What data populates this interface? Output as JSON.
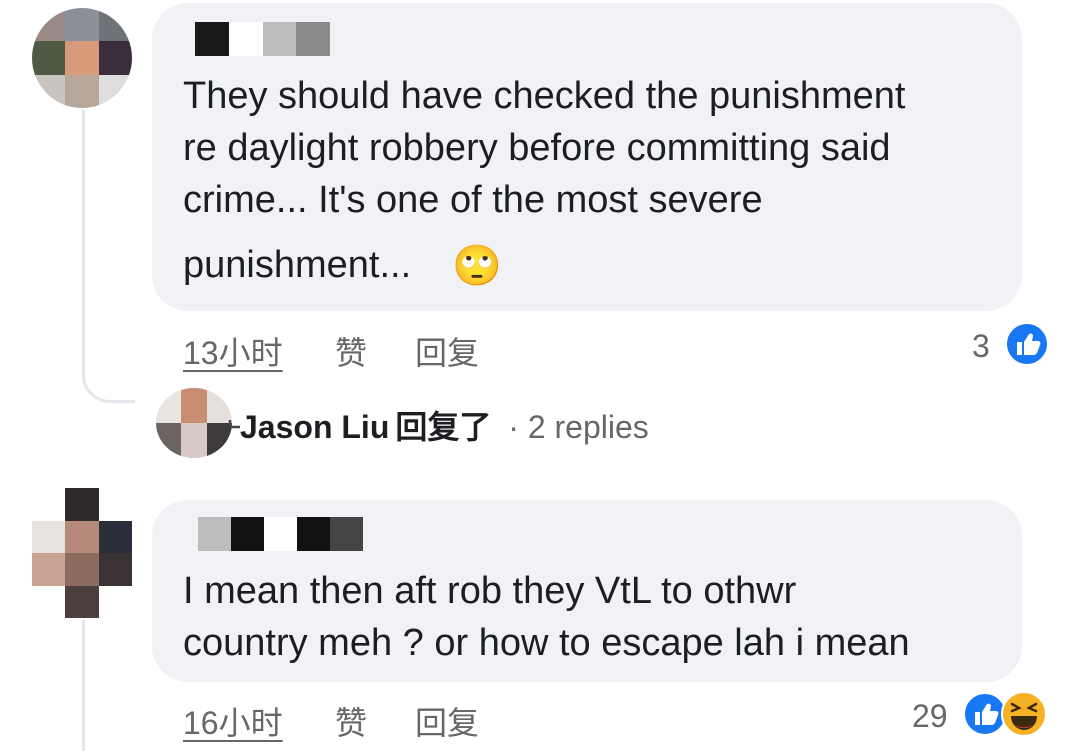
{
  "comments": [
    {
      "text_lines": [
        "They should have checked the punishment",
        "re daylight robbery before committing said",
        "crime... It's one of the most severe",
        "punishment..."
      ],
      "emoji": "🙄",
      "time": "13小时",
      "like_label": "赞",
      "reply_label": "回复",
      "reaction_count": "3",
      "reactions": [
        "like"
      ]
    },
    {
      "text_lines": [
        "I mean then aft rob they VtL to othwr",
        "country meh ? or how to escape lah i mean"
      ],
      "time": "16小时",
      "like_label": "赞",
      "reply_label": "回复",
      "reaction_count": "29",
      "reactions": [
        "like",
        "haha"
      ]
    }
  ],
  "reply_summary": {
    "name": "Jason Liu",
    "action": "回复了",
    "separator": "·",
    "count_text": "2 replies"
  },
  "colors": {
    "bubble": "#f0f2f5",
    "like_blue": "#1877f2",
    "meta_gray": "#65676b",
    "text": "#1c1e21"
  }
}
